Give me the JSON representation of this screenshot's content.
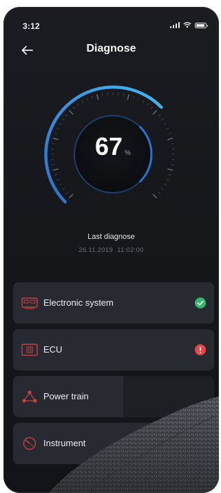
{
  "status_bar": {
    "time": "3:12"
  },
  "header": {
    "title": "Diagnose"
  },
  "gauge": {
    "value": "67",
    "unit": "%",
    "fraction": 0.67
  },
  "last_diagnose": {
    "label": "Last diagnose",
    "date": "26.11.2019",
    "time": "11:02:00"
  },
  "systems": [
    {
      "label": "Electronic system",
      "status": "ok",
      "icon": "dashboard-screen-icon"
    },
    {
      "label": "ECU",
      "status": "error",
      "icon": "chip-icon"
    },
    {
      "label": "Power train",
      "status": "none",
      "icon": "power-train-icon"
    },
    {
      "label": "Instrument",
      "status": "none",
      "icon": "gauge-instrument-icon"
    }
  ],
  "colors": {
    "background": "#15171b",
    "card": "#272a31",
    "accent_blue": "#2f8fd8",
    "ok_green": "#33b86b",
    "error_red": "#e84545",
    "icon_red": "#c94040"
  }
}
